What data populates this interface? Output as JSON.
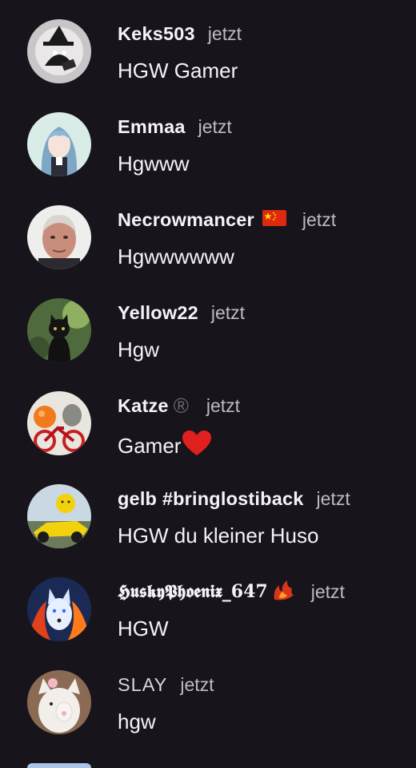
{
  "comments": [
    {
      "username": "Keks503",
      "time": "jetzt",
      "message": "HGW Gamer",
      "avatar_icon": "witch-cat-avatar"
    },
    {
      "username": "Emmaa",
      "time": "jetzt",
      "message": "Hgwww",
      "avatar_icon": "anime-girl-avatar"
    },
    {
      "username": "Necrowmancer",
      "badge_icon": "china-flag-emoji",
      "time": "jetzt",
      "message": "Hgwwwwww",
      "avatar_icon": "man-portrait-avatar"
    },
    {
      "username": "Yellow22",
      "time": "jetzt",
      "message": "Hgw",
      "avatar_icon": "black-cat-avatar"
    },
    {
      "username": "Katze",
      "badge_icon": "registered-sign",
      "badge_text": "®",
      "time": "jetzt",
      "message": "Gamer",
      "message_icon": "red-heart-emoji",
      "avatar_icon": "bicycle-animals-avatar"
    },
    {
      "username": "gelb #bringlostiback",
      "time": "jetzt",
      "message": "HGW du kleiner Huso",
      "avatar_icon": "race-car-avatar"
    },
    {
      "username": "𝕳𝖚𝖘𝖐𝖞𝕻𝖍𝖔𝖊𝖓𝖎𝖝_647",
      "badge_icon": "phoenix-fire-emoji",
      "time": "jetzt",
      "message": "HGW",
      "avatar_icon": "wolf-fire-avatar"
    },
    {
      "username": "SLAY",
      "time": "jetzt",
      "message": "hgw",
      "avatar_icon": "cat-paw-avatar"
    }
  ],
  "colors": {
    "background": "#17141b",
    "text": "#f4f3f6",
    "timestamp": "#bdbac2"
  }
}
